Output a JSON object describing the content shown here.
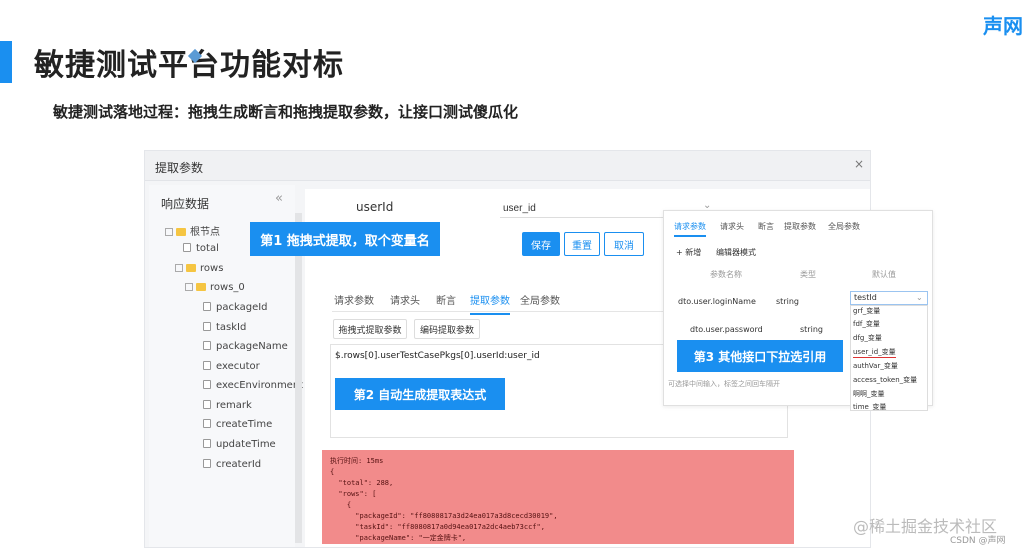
{
  "brand": "声网",
  "title": "敏捷测试平台功能对标",
  "subtitle": "敏捷测试落地过程：拖拽生成断言和拖拽提取参数，让接口测试傻瓜化",
  "dialog": {
    "title": "提取参数",
    "close_symbol": "×"
  },
  "tree": {
    "header": "响应数据",
    "collapse_symbol": "«",
    "root": "根节点",
    "total": "total",
    "rows": "rows",
    "rows0": "rows_0",
    "fields": [
      "packageId",
      "taskId",
      "packageName",
      "executor",
      "execEnvironment",
      "remark",
      "createTime",
      "updateTime",
      "createrId"
    ]
  },
  "field": {
    "label": "userId",
    "value": "user_id",
    "chevron": "⌄"
  },
  "callouts": {
    "c1": "第1 拖拽式提取，取个变量名",
    "c2": "第2 自动生成提取表达式",
    "c3": "第3 其他接口下拉选引用"
  },
  "buttons": {
    "save": "保存",
    "reset": "重置",
    "cancel": "取消"
  },
  "tabs": [
    "请求参数",
    "请求头",
    "断言",
    "提取参数",
    "全局参数"
  ],
  "subbuttons": {
    "drag": "拖拽式提取参数",
    "code": "编码提取参数"
  },
  "expression": "$.rows[0].userTestCasePkgs[0].userId:user_id",
  "response": {
    "time": "执行时间: 15ms",
    "lines": [
      "{",
      "  \"total\": 288,",
      "  \"rows\": [",
      "    {",
      "      \"packageId\": \"ff8080817a3d24ea017a3d8cecd30019\",",
      "      \"taskId\": \"ff8080817a0d94ea017a2dc4aeb73ccf\",",
      "      \"packageName\": \"一定金牌卡\","
    ]
  },
  "popup": {
    "tabs": [
      "请求参数",
      "请求头",
      "断言",
      "提取参数",
      "全局参数"
    ],
    "add": "+ 新增",
    "edit_mode": "编辑器模式",
    "col_name": "参数名称",
    "col_type": "类型",
    "col_default": "默认值",
    "rows": [
      {
        "name": "dto.user.loginName",
        "type": "string"
      },
      {
        "name": "dto.user.password",
        "type": "string"
      }
    ],
    "hint": "可选择中间输入，标签之间回车隔开",
    "select_value": "testId",
    "select_options": [
      "grf_变量",
      "fdf_变量",
      "dfg_变量",
      "user_id_变量",
      "authVar_变量",
      "access_token_变量",
      "啊啊_变量",
      "time_变量"
    ]
  },
  "watermark": "@稀土掘金技术社区",
  "csdn": "CSDN @声网",
  "colors": {
    "accent": "#1a8ff0",
    "response_bg": "#f28b8b"
  }
}
